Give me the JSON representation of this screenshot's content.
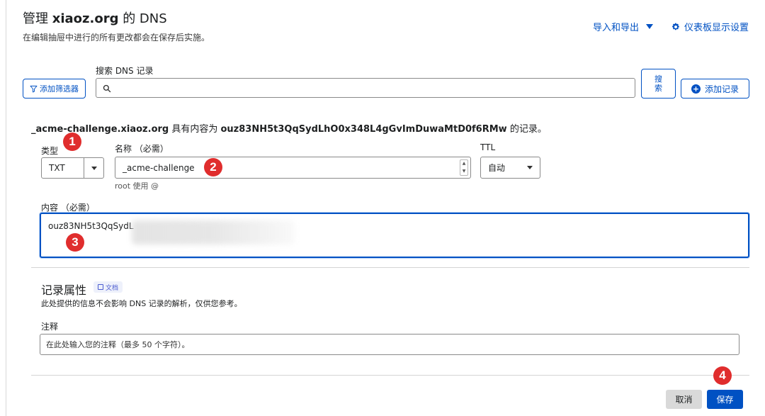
{
  "header": {
    "title_prefix": "管理 ",
    "title_domain": "xiaoz.org",
    "title_suffix": " 的 DNS",
    "subtitle": "在编辑抽屉中进行的所有更改都会在保存后实施。",
    "import_export": "导入和导出",
    "dashboard_settings": "仪表板显示设置"
  },
  "toolbar": {
    "filter_button": "添加筛选器",
    "search_label": "搜索 DNS 记录",
    "search_value": "",
    "search_button_line1": "搜",
    "search_button_line2": "索",
    "add_record_button": "添加记录"
  },
  "record": {
    "name_bold": "_acme-challenge.xiaoz.org",
    "middle_text": " 具有内容为 ",
    "content_bold": "ouz83NH5t3QqSydLhO0x348L4gGvImDuwaMtD0f6RMw",
    "end_text": " 的记录。"
  },
  "form": {
    "type_label": "类型",
    "type_value": "TXT",
    "name_label": "名称 （必需）",
    "name_value": "_acme-challenge",
    "name_hint": "root 使用 @",
    "ttl_label": "TTL",
    "ttl_value": "自动",
    "content_label": "内容 （必需）",
    "content_value": "ouz83NH5t3QqSydL"
  },
  "properties": {
    "title": "记录属性",
    "doc_badge": "文档",
    "description": "此处提供的信息不会影响 DNS 记录的解析，仅供您参考。",
    "notes_label": "注释",
    "notes_placeholder": "在此处输入您的注释（最多 50 个字符）。"
  },
  "actions": {
    "cancel": "取消",
    "save": "保存"
  },
  "markers": [
    "1",
    "2",
    "3",
    "4"
  ],
  "colors": {
    "accent": "#0051c3",
    "marker": "#e02d2d",
    "cancel_bg": "#d9d9d9"
  },
  "icons": {
    "filter": "filter-icon",
    "search": "search-icon",
    "add": "plus-circle-icon",
    "gear": "gear-icon",
    "dropdown": "caret-down-icon",
    "doc": "document-icon"
  }
}
